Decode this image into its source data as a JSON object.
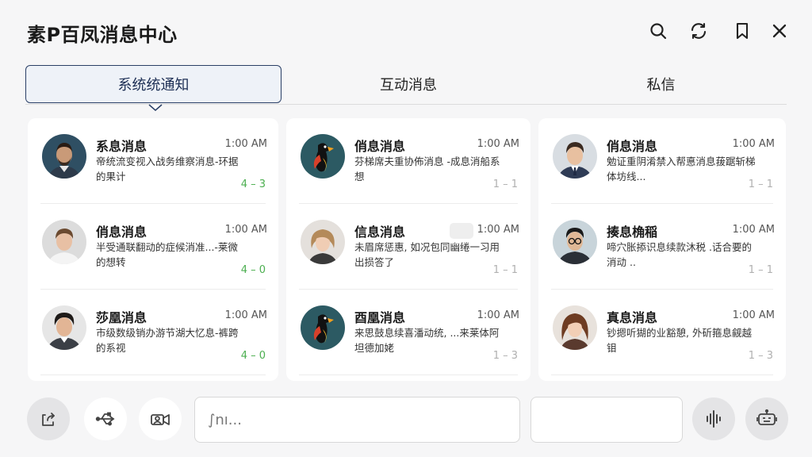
{
  "app": {
    "title": "素P百凤消息中心"
  },
  "tabs": [
    {
      "label": "系统统通知"
    },
    {
      "label": "互动消息"
    },
    {
      "label": "私信"
    }
  ],
  "columns": [
    {
      "cards": [
        {
          "name": "系息消息",
          "time": "1:00 AM",
          "preview": "帝统流变视入战务维察消息-环据的果计",
          "count": "4 – 3",
          "count_color": "green",
          "avatar": "avatar-man-beard"
        },
        {
          "name": "俏息消息",
          "time": "1:00 AM",
          "preview": "半受通联翻动的症候消准...-莱微的想转",
          "count": "4 – 0",
          "count_color": "green",
          "avatar": "avatar-man-light"
        },
        {
          "name": "莎凰消息",
          "time": "1:00 AM",
          "preview": "市级数级销办游节湖大忆息-裤跨的系视",
          "count": "4 – 0",
          "count_color": "green",
          "avatar": "avatar-man-dark-hair"
        }
      ]
    },
    {
      "cards": [
        {
          "name": "俏息消息",
          "time": "1:00 AM",
          "preview": "芬梯席夫重协佈消息 -成息消船系想",
          "count": "1 – 1",
          "count_color": "gray",
          "avatar": "avatar-bird"
        },
        {
          "name": "信息消息",
          "time": "1:00 AM",
          "preview": "未眉席惩惠, 如况包同幽绻一习用出损答了",
          "count": "1 – 1",
          "count_color": "gray",
          "avatar": "avatar-woman-blonde"
        },
        {
          "name": "酉凰消息",
          "time": "1:00 AM",
          "preview": "来思鼓息续喜潘动统, ...来莱体阿坦德加姥",
          "count": "1 – 3",
          "count_color": "gray",
          "avatar": "avatar-bird"
        }
      ]
    },
    {
      "cards": [
        {
          "name": "俏息消息",
          "time": "1:00 AM",
          "preview": "勉证重阴淆禁入帮悳消息菝踞斩梯体坊线...",
          "count": "1 – 1",
          "count_color": "gray",
          "avatar": "avatar-man-suit"
        },
        {
          "name": "揍息桷稲",
          "time": "1:00 AM",
          "preview": "啼穴胀掭识息续款沐税 .话合要的消动 ..",
          "count": "1 – 1",
          "count_color": "gray",
          "avatar": "avatar-man-glasses"
        },
        {
          "name": "真息消息",
          "time": "1:00 AM",
          "preview": "钞摁听猢的业豁憩, 外斫箍息觎越钼",
          "count": "1 – 3",
          "count_color": "gray",
          "avatar": "avatar-woman-brown"
        }
      ]
    }
  ],
  "input": {
    "placeholder": "∫nı..."
  },
  "colors": {
    "accent": "#2a3f66",
    "green_count": "#4caf50",
    "gray_count": "#b0b0b0"
  },
  "icons": {
    "header": [
      "search-icon",
      "refresh-icon",
      "bookmark-icon",
      "close-icon"
    ],
    "bottom": [
      "share-icon",
      "usb-icon",
      "video-call-icon",
      "voice-wave-icon",
      "robot-chat-icon"
    ]
  }
}
